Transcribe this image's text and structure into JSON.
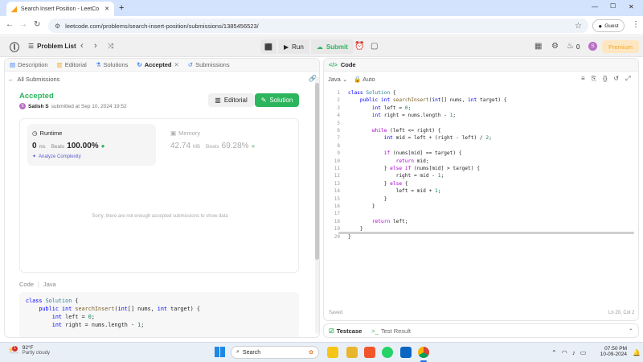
{
  "browser": {
    "tab_title": "Search Insert Position - LeetCo",
    "new_tab_symbol": "+",
    "url": "leetcode.com/problems/search-insert-position/submissions/1385456523/",
    "profile_label": "Guest",
    "window_controls": [
      "—",
      "☐",
      "✕"
    ]
  },
  "lc_nav": {
    "problem_list": "Problem List",
    "run": "Run",
    "submit": "Submit",
    "streak": "0",
    "avatar_letter": "S",
    "premium": "Premium"
  },
  "left_tabs": [
    {
      "label": "Description",
      "active": false
    },
    {
      "label": "Editorial",
      "active": false
    },
    {
      "label": "Solutions",
      "active": false
    },
    {
      "label": "Accepted",
      "active": true
    },
    {
      "label": "Submissions",
      "active": false
    }
  ],
  "submission": {
    "back_label": "All Submissions",
    "status": "Accepted",
    "user": "Satish S",
    "user_initial": "S",
    "submitted_text": "submitted at Sep 10, 2024 19:52",
    "editorial_btn": "Editorial",
    "solution_btn": "Solution",
    "runtime_label": "Runtime",
    "runtime_value": "0",
    "runtime_unit": "ms",
    "beats_label": "Beats",
    "runtime_beats": "100.00%",
    "analyze": "Analyze Complexity",
    "memory_label": "Memory",
    "memory_value": "42.74",
    "memory_unit": "MB",
    "memory_beats": "69.28%",
    "not_enough": "Sorry, there are not enough accepted submissions to show data",
    "code_label": "Code",
    "code_lang": "Java"
  },
  "left_code": [
    "class Solution {",
    "    public int searchInsert(int[] nums, int target) {",
    "        int left = 0;",
    "        int right = nums.length - 1;"
  ],
  "editor": {
    "header": "Code",
    "language": "Java",
    "mode": "Auto",
    "status_left": "Saved",
    "status_right": "Ln 20, Col 2",
    "lines": [
      "class Solution {",
      "    public int searchInsert(int[] nums, int target) {",
      "        int left = 0;",
      "        int right = nums.length - 1;",
      "",
      "        while (left <= right) {",
      "            int mid = left + (right - left) / 2;",
      "",
      "            if (nums[mid] == target) {",
      "                return mid;",
      "            } else if (nums[mid] > target) {",
      "                right = mid - 1;",
      "            } else {",
      "                left = mid + 1;",
      "            }",
      "        }",
      "",
      "        return left;",
      "    }",
      "}"
    ]
  },
  "bottom_tabs": {
    "testcase": "Testcase",
    "test_result": "Test Result"
  },
  "taskbar": {
    "weather_temp": "92°F",
    "weather_desc": "Partly cloudy",
    "search": "Search",
    "time": "07:50 PM",
    "date": "10-09-2024",
    "notification_count": "1"
  }
}
